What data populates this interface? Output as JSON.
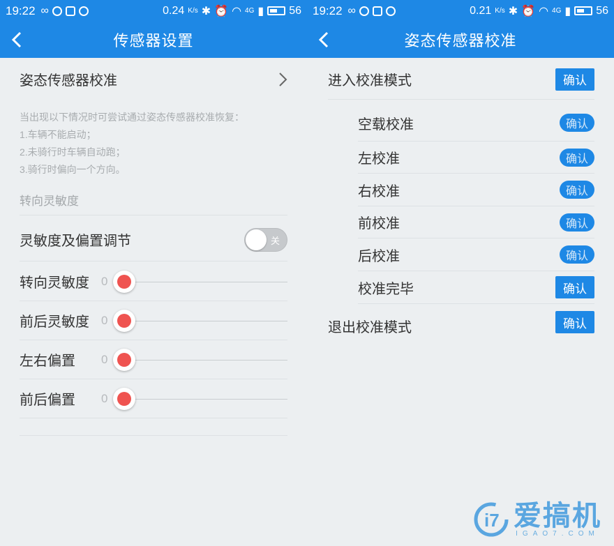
{
  "status": {
    "time": "19:22",
    "left_speed": "0.24",
    "right_speed": "0.21",
    "speed_unit": "K/s",
    "network": "4G",
    "battery": "56"
  },
  "left": {
    "title": "传感器设置",
    "calibration_item": "姿态传感器校准",
    "hint_lines": [
      "当出现以下情况时可尝试通过姿态传感器校准恢复：",
      "1.车辆不能启动；",
      "2.未骑行时车辆自动跑；",
      "3.骑行时偏向一个方向。"
    ],
    "section_label": "转向灵敏度",
    "toggle_label": "灵敏度及偏置调节",
    "toggle_state_text": "关",
    "sliders": [
      {
        "label": "转向灵敏度",
        "value": "0"
      },
      {
        "label": "前后灵敏度",
        "value": "0"
      },
      {
        "label": "左右偏置",
        "value": "0"
      },
      {
        "label": "前后偏置",
        "value": "0"
      }
    ]
  },
  "right": {
    "title": "姿态传感器校准",
    "enter_mode": {
      "label": "进入校准模式",
      "button": "确认"
    },
    "steps": [
      {
        "label": "空载校准",
        "button": "确认"
      },
      {
        "label": "左校准",
        "button": "确认"
      },
      {
        "label": "右校准",
        "button": "确认"
      },
      {
        "label": "前校准",
        "button": "确认"
      },
      {
        "label": "后校准",
        "button": "确认"
      },
      {
        "label": "校准完毕",
        "button": "确认"
      }
    ],
    "exit_mode": {
      "label": "退出校准模式",
      "button": "确认"
    }
  },
  "watermark": {
    "text": "爱搞机",
    "sub": "IGAO7.COM",
    "logo": "i7"
  }
}
